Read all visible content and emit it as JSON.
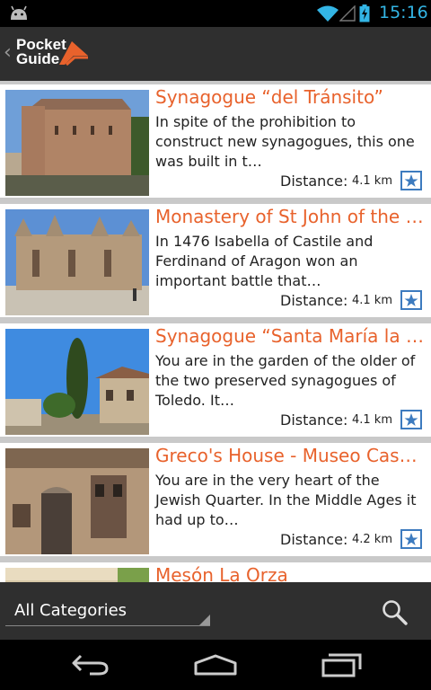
{
  "status_bar": {
    "time": "15:16"
  },
  "action_bar": {
    "logo_line1": "Pocket",
    "logo_line2": "Guide"
  },
  "list": {
    "items": [
      {
        "title": "Synagogue “del Tránsito”",
        "description": "In spite of the prohibition to construct new synagogues, this one was built in t…",
        "distance_label": "Distance:",
        "distance": "4.1 km"
      },
      {
        "title": "Monastery of St John of the …",
        "description": "In 1476 Isabella of Castile and Ferdinand of Aragon won an important battle that…",
        "distance_label": "Distance:",
        "distance": "4.1 km"
      },
      {
        "title": "Synagogue “Santa María la …",
        "description": "You are in the garden of the older of the two preserved synagogues of Toledo. It…",
        "distance_label": "Distance:",
        "distance": "4.1 km"
      },
      {
        "title": "Greco's House - Museo Cas…",
        "description": "You are in the very heart of the Jewish Quarter. In the Middle Ages it had up to…",
        "distance_label": "Distance:",
        "distance": "4.2 km"
      },
      {
        "title": "Mesón La Orza",
        "description": "",
        "distance_label": "",
        "distance": ""
      }
    ]
  },
  "bottom_bar": {
    "category": "All Categories"
  },
  "colors": {
    "accent": "#e8622c",
    "status": "#33b5e5",
    "bar": "#2f2f2f",
    "fav": "#3d7bbf"
  }
}
